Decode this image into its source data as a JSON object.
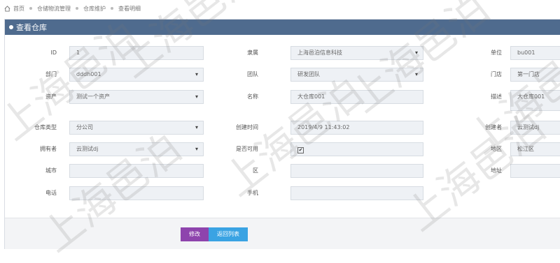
{
  "breadcrumb": [
    "首页",
    "仓储物流管理",
    "仓库维护",
    "查看明细"
  ],
  "panel": {
    "title": "查看仓库"
  },
  "form": {
    "id": {
      "label": "ID",
      "value": "1"
    },
    "owner": {
      "label": "隶属",
      "value": "上海邑泊信息科技"
    },
    "unit": {
      "label": "单位",
      "value": "bu001"
    },
    "dept": {
      "label": "部门",
      "value": "dddh001"
    },
    "team": {
      "label": "团队",
      "value": "研发团队"
    },
    "store": {
      "label": "门店",
      "value": "第一门店"
    },
    "asset": {
      "label": "资产",
      "value": "测试一个资产"
    },
    "name": {
      "label": "名称",
      "value": "大仓库001"
    },
    "desc": {
      "label": "描述",
      "value": "大仓库001"
    },
    "type": {
      "label": "仓库类型",
      "value": "分公司"
    },
    "created_at": {
      "label": "创建时间",
      "value": "2019/4/9 11:43:02"
    },
    "creator": {
      "label": "创建者",
      "value": "云测试dj"
    },
    "holder": {
      "label": "拥有者",
      "value": "云测试dj"
    },
    "available": {
      "label": "是否可用",
      "checked_glyph": "✔"
    },
    "region": {
      "label": "地区",
      "value": "松江区"
    },
    "city": {
      "label": "城市",
      "value": ""
    },
    "district": {
      "label": "区",
      "value": ""
    },
    "address": {
      "label": "地址",
      "value": ""
    },
    "phone": {
      "label": "电话",
      "value": ""
    },
    "mobile": {
      "label": "手机",
      "value": ""
    }
  },
  "buttons": {
    "edit": "修改",
    "back": "返回列表"
  },
  "watermark": "上海邑泊"
}
